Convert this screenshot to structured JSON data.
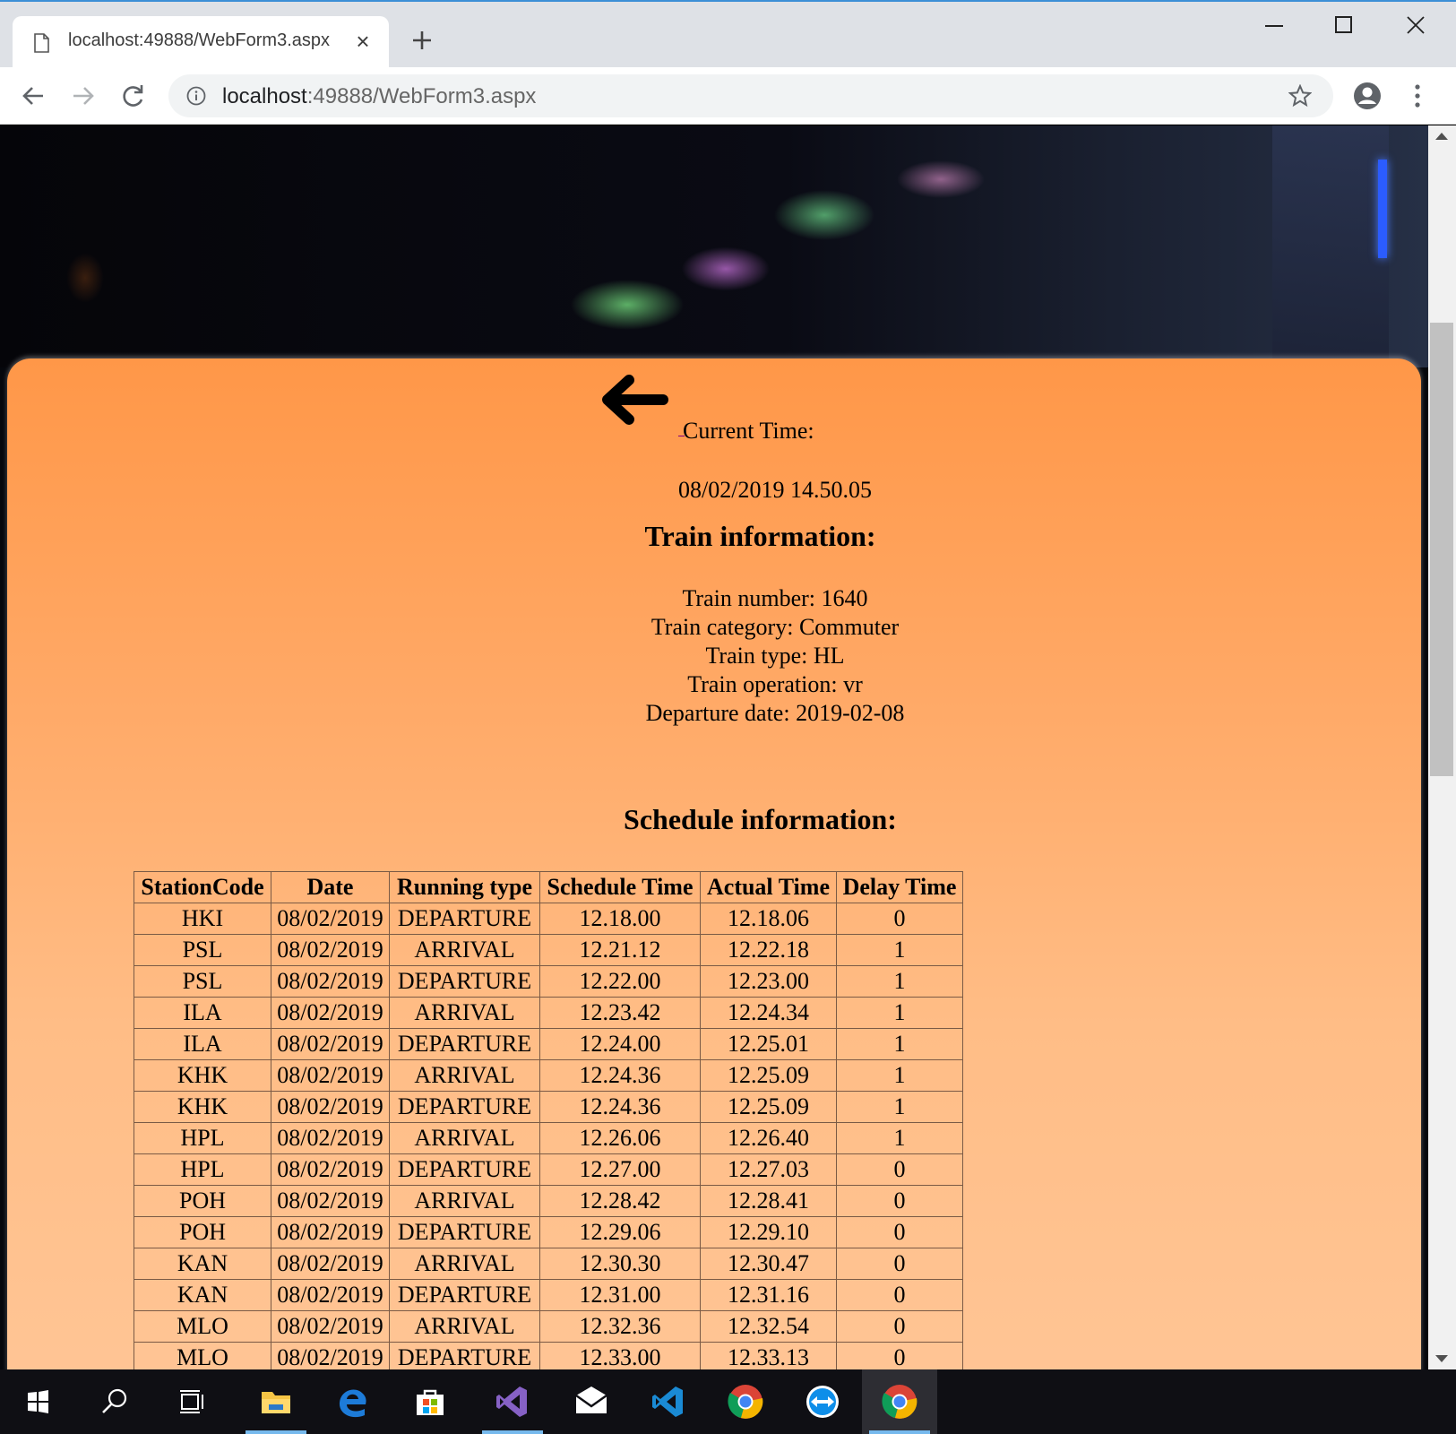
{
  "browser": {
    "tab_title": "localhost:49888/WebForm3.aspx",
    "url_host": "localhost",
    "url_rest": ":49888/WebForm3.aspx"
  },
  "page": {
    "current_time_label": "Current Time:",
    "current_time_value": "08/02/2019 14.50.05",
    "train_heading": "Train information:",
    "train_info": [
      "Train number: 1640",
      "Train category: Commuter",
      "Train type: HL",
      "Train operation: vr",
      "Departure date: 2019-02-08"
    ],
    "schedule_heading": "Schedule information:",
    "schedule": {
      "columns": [
        "StationCode",
        "Date",
        "Running type",
        "Schedule Time",
        "Actual Time",
        "Delay Time"
      ],
      "rows": [
        [
          "HKI",
          "08/02/2019",
          "DEPARTURE",
          "12.18.00",
          "12.18.06",
          "0"
        ],
        [
          "PSL",
          "08/02/2019",
          "ARRIVAL",
          "12.21.12",
          "12.22.18",
          "1"
        ],
        [
          "PSL",
          "08/02/2019",
          "DEPARTURE",
          "12.22.00",
          "12.23.00",
          "1"
        ],
        [
          "ILA",
          "08/02/2019",
          "ARRIVAL",
          "12.23.42",
          "12.24.34",
          "1"
        ],
        [
          "ILA",
          "08/02/2019",
          "DEPARTURE",
          "12.24.00",
          "12.25.01",
          "1"
        ],
        [
          "KHK",
          "08/02/2019",
          "ARRIVAL",
          "12.24.36",
          "12.25.09",
          "1"
        ],
        [
          "KHK",
          "08/02/2019",
          "DEPARTURE",
          "12.24.36",
          "12.25.09",
          "1"
        ],
        [
          "HPL",
          "08/02/2019",
          "ARRIVAL",
          "12.26.06",
          "12.26.40",
          "1"
        ],
        [
          "HPL",
          "08/02/2019",
          "DEPARTURE",
          "12.27.00",
          "12.27.03",
          "0"
        ],
        [
          "POH",
          "08/02/2019",
          "ARRIVAL",
          "12.28.42",
          "12.28.41",
          "0"
        ],
        [
          "POH",
          "08/02/2019",
          "DEPARTURE",
          "12.29.06",
          "12.29.10",
          "0"
        ],
        [
          "KAN",
          "08/02/2019",
          "ARRIVAL",
          "12.30.30",
          "12.30.47",
          "0"
        ],
        [
          "KAN",
          "08/02/2019",
          "DEPARTURE",
          "12.31.00",
          "12.31.16",
          "0"
        ],
        [
          "MLO",
          "08/02/2019",
          "ARRIVAL",
          "12.32.36",
          "12.32.54",
          "0"
        ],
        [
          "MLO",
          "08/02/2019",
          "DEPARTURE",
          "12.33.00",
          "12.33.13",
          "0"
        ]
      ]
    }
  },
  "taskbar": {
    "icons": [
      "windows-start-icon",
      "search-icon",
      "task-view-icon",
      "file-explorer-icon",
      "edge-icon",
      "store-icon",
      "visual-studio-icon",
      "mail-icon",
      "vscode-icon",
      "chrome-icon",
      "teamviewer-icon",
      "chrome-icon"
    ]
  },
  "colors": {
    "panel_top": "#ff9748",
    "panel_bottom": "#ffc697",
    "taskbar": "#0f0f14",
    "active_indicator": "#76b9ed"
  }
}
